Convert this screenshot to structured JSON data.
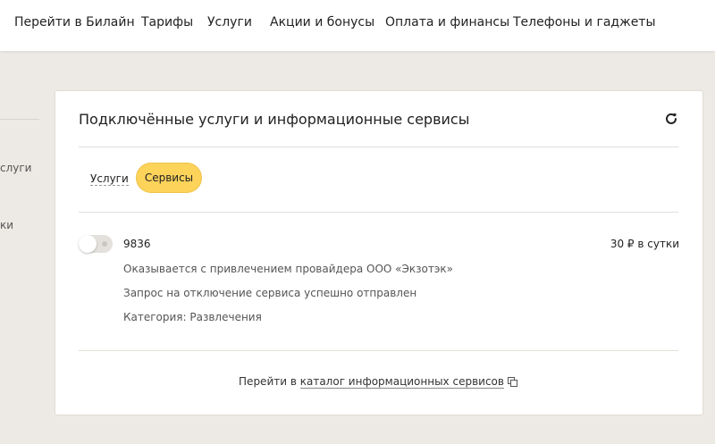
{
  "topnav": {
    "items": [
      {
        "label": "Перейти в Билайн"
      },
      {
        "label": "Тарифы"
      },
      {
        "label": "Услуги"
      },
      {
        "label": "Акции и бонусы"
      },
      {
        "label": "Оплата и финансы"
      },
      {
        "label": "Телефоны и гаджеты"
      }
    ]
  },
  "sidebar": {
    "partial_label_1": "слуги",
    "partial_link_2": "ки"
  },
  "card": {
    "title": "Подключённые услуги и информационные сервисы",
    "refresh_icon": "refresh-icon",
    "tabs": [
      {
        "label": "Услуги",
        "active": false
      },
      {
        "label": "Сервисы",
        "active": true
      }
    ],
    "service": {
      "name": "9836",
      "price": "30 ₽ в сутки",
      "provider": "Оказывается с привлечением провайдера ООО «Экзотэк»",
      "status": "Запрос на отключение сервиса успешно отправлен",
      "category": "Категория: Развлечения"
    },
    "footer": {
      "prefix": "Перейти в ",
      "link_label": "каталог информационных сервисов",
      "link_icon": "external-copy-icon"
    }
  },
  "colors": {
    "accent_yellow": "#fdd35a",
    "page_bg": "#ede9e4"
  }
}
